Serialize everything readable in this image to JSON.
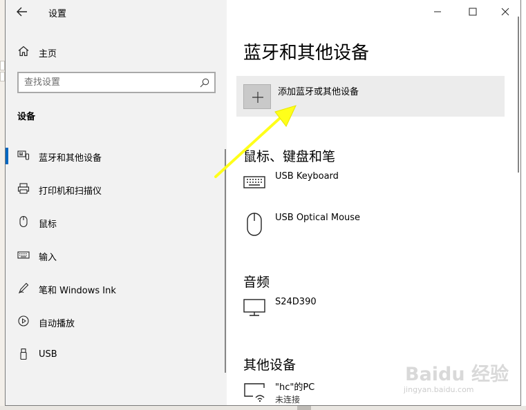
{
  "window": {
    "title": "设置",
    "back_icon": "arrow-left-icon",
    "controls": {
      "minimize": "minimize-icon",
      "maximize": "maximize-icon",
      "close": "close-icon"
    }
  },
  "sidebar": {
    "home_label": "主页",
    "home_icon": "home-icon",
    "search": {
      "placeholder": "查找设置",
      "icon": "search-icon"
    },
    "section_title": "设备",
    "selected_index": 0,
    "items": [
      {
        "label": "蓝牙和其他设备",
        "icon": "bluetooth-devices-icon"
      },
      {
        "label": "打印机和扫描仪",
        "icon": "printer-icon"
      },
      {
        "label": "鼠标",
        "icon": "mouse-icon"
      },
      {
        "label": "输入",
        "icon": "keyboard-icon"
      },
      {
        "label": "笔和 Windows Ink",
        "icon": "pen-icon"
      },
      {
        "label": "自动播放",
        "icon": "autoplay-icon"
      },
      {
        "label": "USB",
        "icon": "usb-icon"
      }
    ]
  },
  "main": {
    "title": "蓝牙和其他设备",
    "add_device_label": "添加蓝牙或其他设备",
    "groups": [
      {
        "title": "鼠标、键盘和笔",
        "devices": [
          {
            "name": "USB Keyboard",
            "icon": "keyboard-icon"
          },
          {
            "name": "USB Optical Mouse",
            "icon": "mouse-icon"
          }
        ]
      },
      {
        "title": "音频",
        "devices": [
          {
            "name": "S24D390",
            "icon": "monitor-icon"
          }
        ]
      },
      {
        "title": "其他设备",
        "devices": [
          {
            "name": "\"hc\"的PC",
            "status": "未连接",
            "icon": "wireless-display-icon"
          }
        ]
      }
    ]
  },
  "annotation": {
    "arrow_color": "#ffff00"
  },
  "watermark": {
    "text": "Baidu 经验",
    "sub": "jingyan.baidu.com"
  },
  "colors": {
    "accent": "#0067c0",
    "sidebar_bg": "#f2f2f2",
    "tile_bg": "#ececec"
  }
}
